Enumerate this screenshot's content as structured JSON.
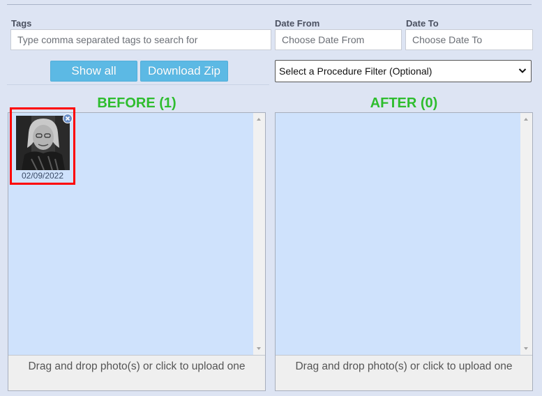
{
  "filters": {
    "tags_label": "Tags",
    "tags_placeholder": "Type comma separated tags to search for",
    "date_from_label": "Date From",
    "date_from_placeholder": "Choose Date From",
    "date_to_label": "Date To",
    "date_to_placeholder": "Choose Date To",
    "show_all_label": "Show all",
    "download_zip_label": "Download Zip",
    "procedure_filter_selected": "Select a Procedure Filter (Optional)"
  },
  "before": {
    "title": "BEFORE (1)",
    "photos": [
      {
        "date": "02/09/2022"
      }
    ],
    "upload_hint": "Drag and drop photo(s) or click to upload one"
  },
  "after": {
    "title": "AFTER (0)",
    "photos": [],
    "upload_hint": "Drag and drop photo(s) or click to upload one"
  },
  "colors": {
    "header_green": "#2ebd2e",
    "button_blue": "#5cb9e4",
    "dropzone_blue": "#cfe2fc",
    "selection_red": "#ff0000"
  },
  "icons": {
    "remove_photo": "close-icon",
    "select_arrow": "chevron-down-icon",
    "scroll_up": "scroll-up-arrow-icon",
    "scroll_down": "scroll-down-arrow-icon"
  }
}
